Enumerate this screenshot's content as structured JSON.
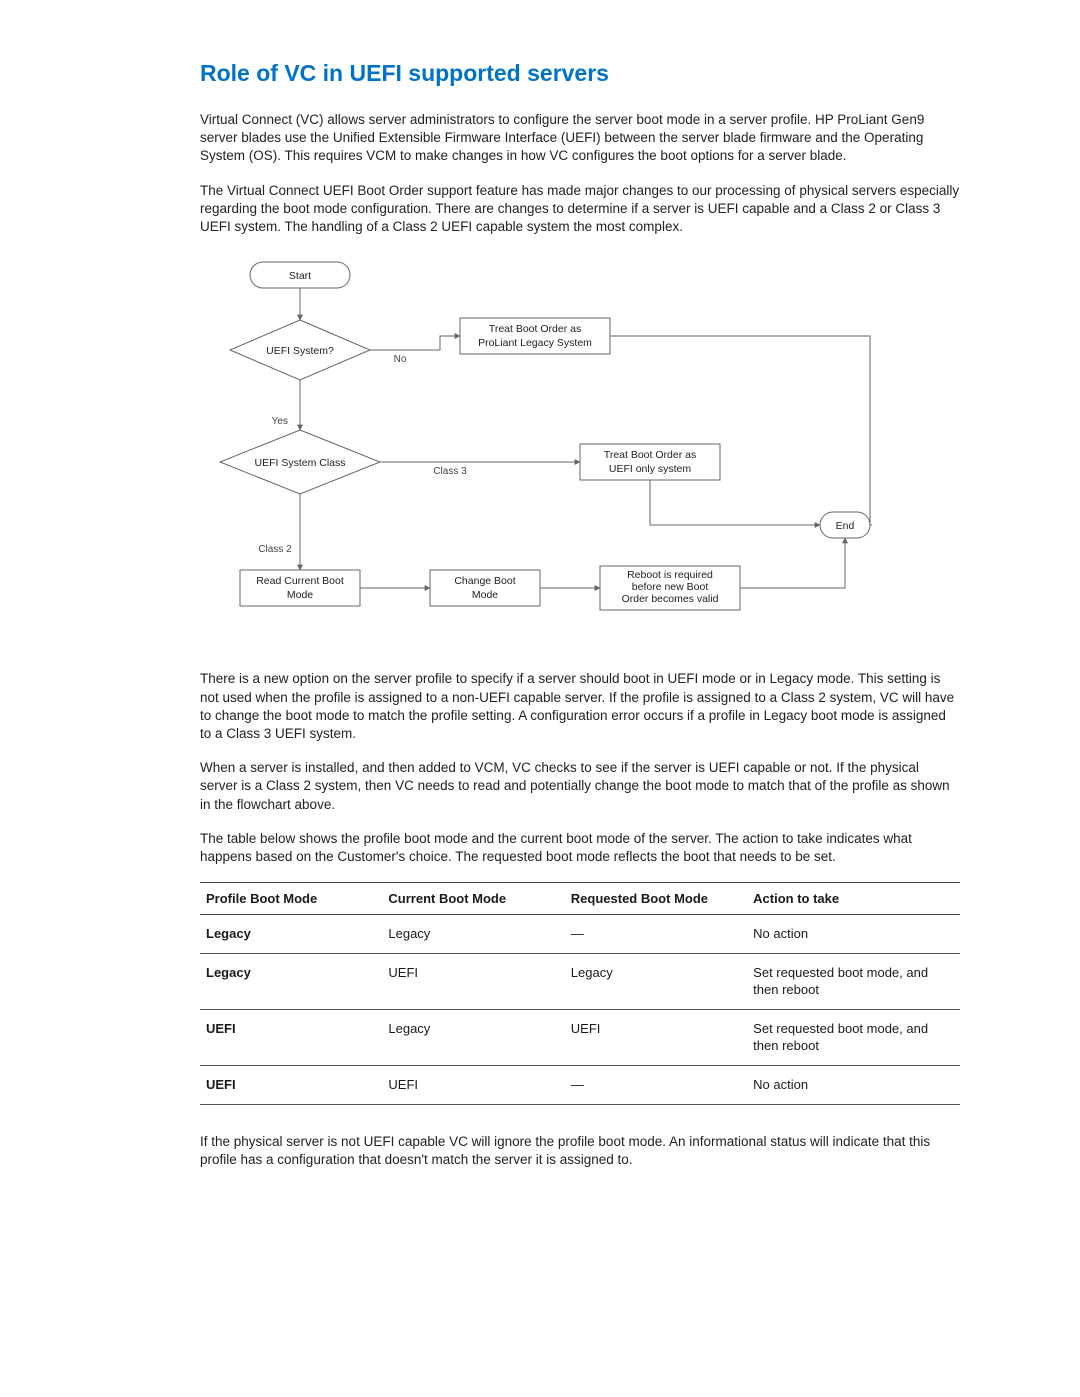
{
  "title": "Role of VC in UEFI supported servers",
  "paragraphs": {
    "p1": "Virtual Connect (VC) allows server administrators to configure the server boot mode in a server profile. HP ProLiant Gen9 server blades use the Unified Extensible Firmware Interface (UEFI) between the server blade firmware and the Operating System (OS). This requires VCM to make changes in how VC configures the boot options for a server blade.",
    "p2": "The Virtual Connect UEFI Boot Order support feature has made major changes to our processing of physical servers especially regarding the boot mode configuration. There are changes to determine if a server is UEFI capable and a Class 2 or Class 3 UEFI system. The handling of a Class 2 UEFI capable system the most complex.",
    "p3": "There is a new option on the server profile to specify if a server should boot in UEFI mode or in Legacy mode. This setting is not used when the profile is assigned to a non-UEFI capable server. If the profile is assigned to a Class 2 system, VC will have to change the boot mode to match the profile setting. A configuration error occurs if a profile in Legacy boot mode is assigned to a Class 3 UEFI system.",
    "p4": "When a server is installed, and then added to VCM, VC checks to see if the server is UEFI capable or not. If the physical server is a Class 2 system, then VC needs to read and potentially change the boot mode to match that of the profile as shown in the flowchart above.",
    "p5": "The table below shows the profile boot mode and the current boot mode of the server. The action to take indicates what happens based on the Customer's choice. The requested boot mode reflects the boot that needs to be set.",
    "p6": "If the physical server is not UEFI capable VC will ignore the profile boot mode. An informational status will indicate that this profile has a configuration that doesn't match the server it is assigned to."
  },
  "flowchart": {
    "start": "Start",
    "q_uefi": "UEFI System?",
    "q_class": "UEFI System Class",
    "legacy_box_l1": "Treat Boot Order as",
    "legacy_box_l2": "ProLiant Legacy System",
    "uefi_box_l1": "Treat Boot Order as",
    "uefi_box_l2": "UEFI only system",
    "read_l1": "Read Current Boot",
    "read_l2": "Mode",
    "change_l1": "Change Boot",
    "change_l2": "Mode",
    "reboot_l1": "Reboot is required",
    "reboot_l2": "before new Boot",
    "reboot_l3": "Order becomes valid",
    "end": "End",
    "edge_no": "No",
    "edge_yes": "Yes",
    "edge_class2": "Class 2",
    "edge_class3": "Class 3"
  },
  "table": {
    "headers": {
      "h1": "Profile Boot Mode",
      "h2": "Current Boot Mode",
      "h3": "Requested Boot Mode",
      "h4": "Action to take"
    },
    "rows": [
      {
        "c1": "Legacy",
        "c2": "Legacy",
        "c3": "—",
        "c4": "No action"
      },
      {
        "c1": "Legacy",
        "c2": "UEFI",
        "c3": "Legacy",
        "c4": "Set requested boot mode, and then reboot"
      },
      {
        "c1": "UEFI",
        "c2": "Legacy",
        "c3": "UEFI",
        "c4": "Set requested boot mode, and then reboot"
      },
      {
        "c1": "UEFI",
        "c2": "UEFI",
        "c3": "—",
        "c4": "No action"
      }
    ]
  }
}
